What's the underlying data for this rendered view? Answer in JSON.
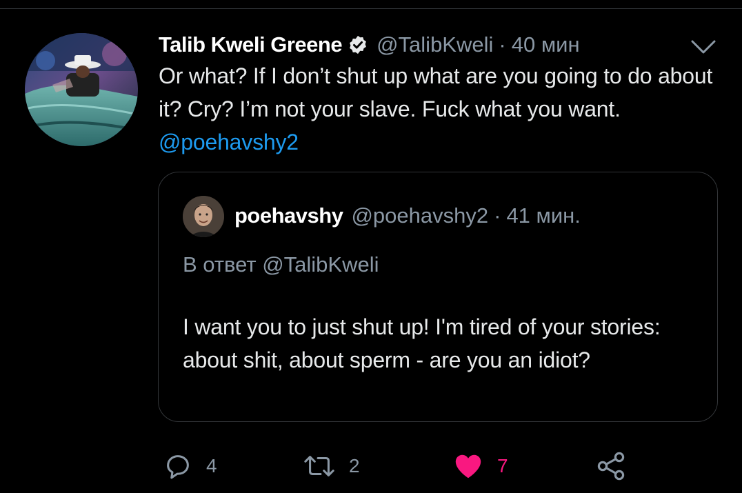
{
  "tweet": {
    "author_name": "Talib Kweli Greene",
    "author_handle": "@TalibKweli",
    "separator": "·",
    "time": "40 мин",
    "text_before_mention": "Or what? If I don’t shut up what are you going to do about it? Cry? I’m not your slave. Fuck what you want. ",
    "mention": "@poehavshy2",
    "icons": {
      "verified": "verified-badge-icon",
      "menu": "chevron-down-icon"
    }
  },
  "quoted_tweet": {
    "author_name": "poehavshy",
    "author_handle": "@poehavshy2",
    "separator": "·",
    "time": "41 мин.",
    "reply_to": "В ответ @TalibKweli",
    "text": "I want you to just shut up! I'm tired of your stories: about shit, about sperm - are you an idiot?"
  },
  "actions": {
    "reply_count": "4",
    "retweet_count": "2",
    "like_count": "7",
    "like_color": "#f91880",
    "icons": [
      "reply-icon",
      "retweet-icon",
      "like-heart-icon",
      "share-icon"
    ]
  },
  "colors": {
    "background": "#000000",
    "text": "#e7e9ea",
    "secondary": "#8b98a5",
    "link": "#1d9bf0",
    "border": "#333639"
  }
}
